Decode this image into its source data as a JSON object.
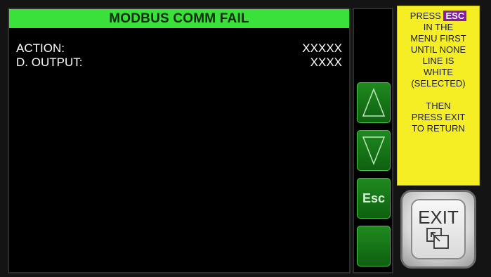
{
  "screen": {
    "title": "MODBUS COMM FAIL",
    "rows": [
      {
        "label": "ACTION:",
        "value": "XXXXX"
      },
      {
        "label": "D. OUTPUT:",
        "value": "XXXX"
      }
    ]
  },
  "nav": {
    "up_icon": "triangle-up-icon",
    "down_icon": "triangle-down-icon",
    "esc_label": "Esc"
  },
  "help": {
    "prefix": "PRESS",
    "esc_tag": "ESC",
    "lines": [
      "IN THE",
      "MENU FIRST",
      "UNTIL NONE",
      "LINE IS",
      "WHITE",
      "(SELECTED)"
    ],
    "lines2": [
      "THEN",
      "PRESS EXIT",
      "TO RETURN"
    ]
  },
  "exit": {
    "label": "EXIT",
    "icon": "window-exit-icon"
  },
  "colors": {
    "title_bg": "#39e13a",
    "help_bg": "#f5ee25",
    "esc_tag_bg": "#8a1aa8",
    "nav_btn": "#1f8a1f"
  }
}
